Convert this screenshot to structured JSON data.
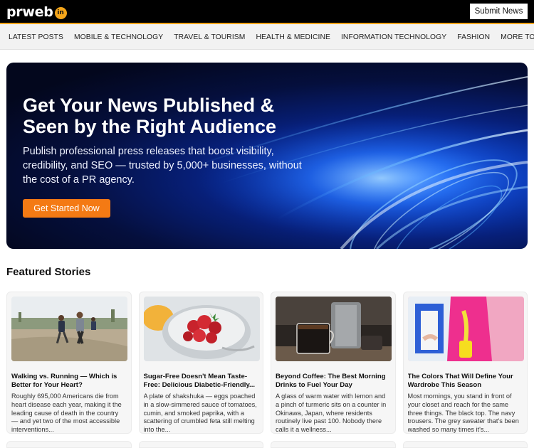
{
  "header": {
    "logo_text": "prweb",
    "logo_badge": "in",
    "submit_label": "Submit News"
  },
  "nav": {
    "items": [
      {
        "label": "LATEST POSTS"
      },
      {
        "label": "MOBILE & TECHNOLOGY"
      },
      {
        "label": "TRAVEL & TOURISM"
      },
      {
        "label": "HEALTH & MEDICINE"
      },
      {
        "label": "INFORMATION TECHNOLOGY"
      },
      {
        "label": "FASHION"
      },
      {
        "label": "MORE TOPICS"
      }
    ]
  },
  "hero": {
    "title": "Get Your News Published & Seen by the Right Audience",
    "subtitle": "Publish professional press releases that boost visibility, credibility, and SEO — trusted by 5,000+ businesses, without the cost of a PR agency.",
    "cta_label": "Get Started Now"
  },
  "featured": {
    "heading": "Featured Stories",
    "cards": [
      {
        "title": "Walking vs. Running — Which is Better for Your Heart?",
        "excerpt": "Roughly 695,000 Americans die from heart disease each year, making it the leading cause of death in the country — and yet two of the most accessible interventions...",
        "image": "runners-photo"
      },
      {
        "title": "Sugar-Free Doesn't Mean Taste-Free: Delicious Diabetic-Friendly...",
        "excerpt": "A plate of shakshuka — eggs poached in a slow-simmered sauce of tomatoes, cumin, and smoked paprika, with a scattering of crumbled feta still melting into the...",
        "image": "strawberries-photo"
      },
      {
        "title": "Beyond Coffee: The Best Morning Drinks to Fuel Your Day",
        "excerpt": "A glass of warm water with lemon and a pinch of turmeric sits on a counter in Okinawa, Japan, where residents routinely live past 100. Nobody there calls it a wellness...",
        "image": "coffee-photo"
      },
      {
        "title": "The Colors That Will Define Your Wardrobe This Season",
        "excerpt": "Most mornings, you stand in front of your closet and reach for the same three things. The black top. The navy trousers. The grey sweater that's been washed so many times it's...",
        "image": "fashion-photo"
      }
    ]
  },
  "colors": {
    "accent": "#f47a14",
    "logo_badge": "#f4a51a",
    "hero_bg": "#050f3d"
  }
}
